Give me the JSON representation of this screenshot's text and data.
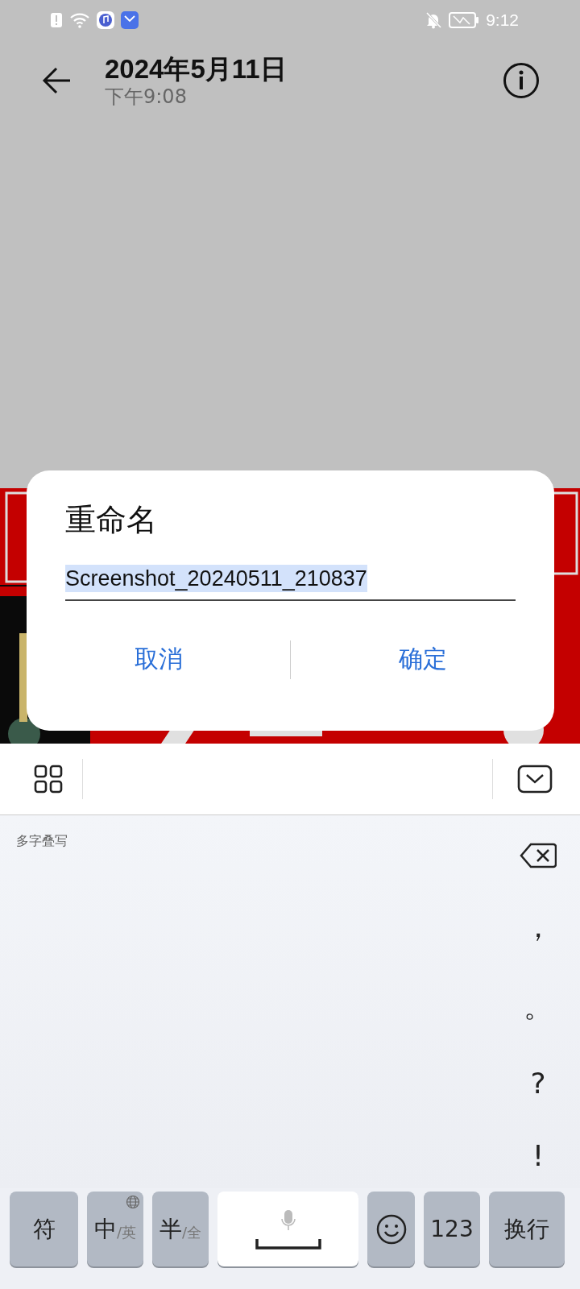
{
  "status_bar": {
    "time": "9:12"
  },
  "header": {
    "title": "2024年5月11日",
    "subtitle": "下午9:08"
  },
  "dialog": {
    "title": "重命名",
    "field": {
      "value": "Screenshot_20240511_210837",
      "selected": true
    },
    "buttons": [
      "取消",
      "确定"
    ]
  },
  "keyboard": {
    "mode_label": "多字叠写",
    "punctuation": [
      "，",
      "。",
      "?",
      "!"
    ],
    "keys": [
      {
        "kind": "text",
        "label": "符"
      },
      {
        "kind": "language_toggle",
        "main": "中",
        "alt": "/英"
      },
      {
        "kind": "toggle",
        "main": "半",
        "alt": "/全"
      },
      {
        "kind": "space"
      },
      {
        "kind": "emoji"
      },
      {
        "kind": "text",
        "label": "123"
      },
      {
        "kind": "text",
        "label": "换行"
      }
    ]
  }
}
